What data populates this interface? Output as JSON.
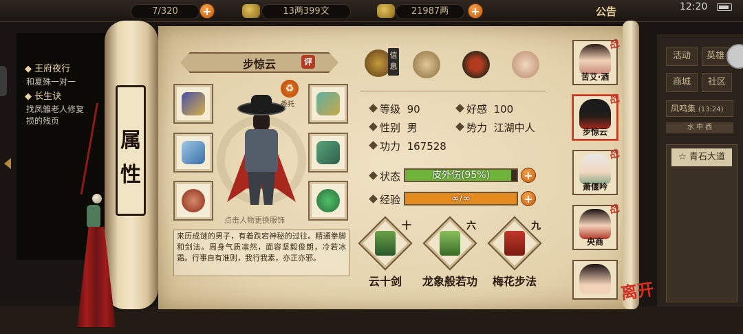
{
  "topbar": {
    "stamina": "7/320",
    "money_text": "13两399文",
    "gold_text": "21987两",
    "notice_label": "公告",
    "clock": "12:20"
  },
  "quest_panel": {
    "items": [
      {
        "title": "王府夜行",
        "desc": "和夏殊一对一"
      },
      {
        "title": "长生诀",
        "desc": "找凤雏老人修复"
      }
    ],
    "extra_line": "损的残页"
  },
  "right_menu": {
    "buttons": [
      "活动",
      "商城",
      "社区"
    ],
    "partial_button": "英雄",
    "fengming": "凤鸣集",
    "fengming_time": "(13:24)",
    "bar_text": "水 中 西",
    "location_tab": "青石大道"
  },
  "scroll": {
    "title_chars": [
      "属",
      "性"
    ]
  },
  "character": {
    "name": "步惊云",
    "rate_badge": "评",
    "weituo_label": "委托",
    "equip_hint": "点击人物更换服饰",
    "description": "来历成谜的男子，有着跌宕神秘的过往。精通拳脚和剑法。周身气质凛然，面容坚毅俊朗，冷若冰霜。行事自有准则，我行我素，亦正亦邪。"
  },
  "top_icons": [
    {
      "name": "info",
      "tag": "信息"
    },
    {
      "name": "map-scroll"
    },
    {
      "name": "bagua"
    },
    {
      "name": "meridian-figure"
    }
  ],
  "stats": {
    "level_label": "等级",
    "level": "90",
    "favor_label": "好感",
    "favor": "100",
    "gender_label": "性别",
    "gender": "男",
    "faction_label": "势力",
    "faction": "江湖中人",
    "power_label": "功力",
    "power": "167528"
  },
  "bars": {
    "status_label": "状态",
    "status_text": "皮外伤(95%)",
    "status_fraction": 0.95,
    "exp_label": "经验",
    "exp_text": "∞/∞",
    "exp_fraction": 1.0
  },
  "skills": [
    {
      "name": "云十剑",
      "level": "十"
    },
    {
      "name": "龙象般若功",
      "level": "六"
    },
    {
      "name": "梅花步法",
      "level": "九"
    }
  ],
  "roster": [
    {
      "name": "苦艾·酒",
      "battle": "战"
    },
    {
      "name": "步惊云",
      "battle": "战"
    },
    {
      "name": "萧偃吟",
      "battle": "战"
    },
    {
      "name": "央商",
      "battle": "战"
    },
    {
      "name": ""
    }
  ],
  "leave_label": "离开",
  "colors": {
    "status_fill": "#6fb43a",
    "exp_fill": "#e58a1e",
    "accent_red": "#c0392b"
  }
}
